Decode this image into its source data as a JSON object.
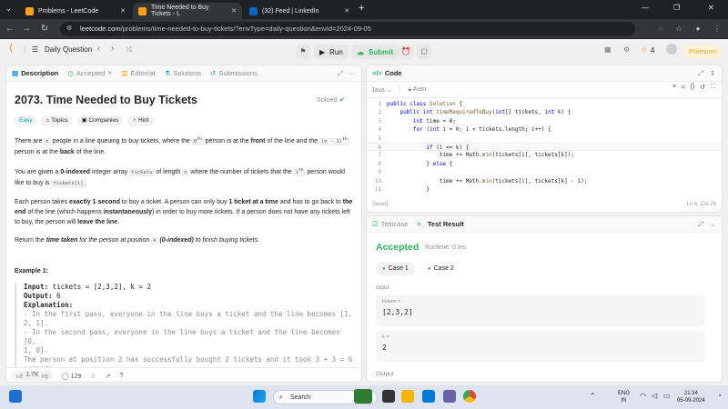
{
  "browser": {
    "tabs": [
      {
        "title": "Problems - LeetCode",
        "active": false
      },
      {
        "title": "Time Needed to Buy Tickets - L",
        "active": true
      },
      {
        "title": "(32) Feed | LinkedIn",
        "active": false
      }
    ],
    "new_tab": "+",
    "url_host": "leetcode.com",
    "url_path": "/problems/time-needed-to-buy-tickets/?envType=daily-question&envId=2024-09-05"
  },
  "header": {
    "daily_question": "Daily Question",
    "run": "Run",
    "submit": "Submit",
    "streak_count": "4",
    "premium": "Premium"
  },
  "description": {
    "tabs": [
      "Description",
      "Accepted",
      "Editorial",
      "Solutions",
      "Submissions"
    ],
    "title": "2073. Time Needed to Buy Tickets",
    "solved": "Solved",
    "tags": [
      "Easy",
      "Topics",
      "Companies",
      "Hint"
    ],
    "p1": {
      "a": "There are ",
      "n": "n",
      "b": " people in a line queuing to buy tickets, where the ",
      "zeroth": "0",
      "sup_th": "th",
      "c": " person is at the ",
      "front": "front",
      "d": " of the line and the ",
      "nminus1": "(n - 1)",
      "e": " person is at the ",
      "back": "back",
      "f": " of the line."
    },
    "p2": {
      "a": "You are given a ",
      "zero_indexed": "0-indexed",
      "b": " integer array ",
      "tickets": "tickets",
      "c": " of length ",
      "n": "n",
      "d": " where the number of tickets that the ",
      "i": "i",
      "e": " person would like to buy is ",
      "ticketsi": "tickets[i]",
      "f": "."
    },
    "p3": {
      "a": "Each person takes ",
      "one_second": "exactly 1 second",
      "b": " to buy a ticket. A person can only buy ",
      "one_ticket": "1 ticket at a time",
      "c": " and has to go back to ",
      "the_end": "the end",
      "d": " of the line (which happens ",
      "instantaneously": "instantaneously",
      "e": ") in order to buy more tickets. If a person does not have any tickets left to buy, the person will ",
      "leave": "leave the line",
      "f": "."
    },
    "p4": {
      "a": "Return the ",
      "time_taken": "time taken",
      "b": " for the person at position ",
      "k": "k",
      "c": " ",
      "zero_indexed": "(0-indexed)",
      "d": " to finish buying tickets."
    },
    "example_title": "Example 1:",
    "example": {
      "input_label": "Input:",
      "input_value": " tickets = [2,3,2], k = 2",
      "output_label": "Output:",
      "output_value": " 6",
      "explanation_label": "Explanation:",
      "lines": [
        "- In the first pass, everyone in the line buys a ticket and the line becomes [1,",
        "2, 1].",
        "- In the second pass, everyone in the line buys a ticket and the line becomes [0,",
        "1, 0].",
        "The person at position 2 has successfully bought 2 tickets and it took 3 + 3 = 6",
        "seconds."
      ]
    },
    "footer": {
      "likes": "1.7K",
      "comments": "129"
    }
  },
  "code": {
    "tab": "Code",
    "language": "Java",
    "mode": "Auto",
    "lines": [
      {
        "n": "1",
        "tokens": [
          [
            "kw",
            "public class "
          ],
          [
            "fn",
            "Solution"
          ],
          [
            "",
            " {"
          ]
        ]
      },
      {
        "n": "2",
        "tokens": [
          [
            "",
            "    "
          ],
          [
            "kw",
            "public int "
          ],
          [
            "fn",
            "timeRequiredToBuy"
          ],
          [
            "",
            "("
          ],
          [
            "kw",
            "int"
          ],
          [
            "",
            "[] tickets, "
          ],
          [
            "kw",
            "int"
          ],
          [
            "",
            " k) {"
          ]
        ]
      },
      {
        "n": "3",
        "tokens": [
          [
            "",
            "        "
          ],
          [
            "kw",
            "int"
          ],
          [
            "",
            " time = 0;"
          ]
        ]
      },
      {
        "n": "4",
        "tokens": [
          [
            "",
            "        "
          ],
          [
            "kw",
            "for"
          ],
          [
            "",
            " ("
          ],
          [
            "kw",
            "int"
          ],
          [
            "",
            " i = 0; i < tickets.length; i++) {"
          ]
        ]
      },
      {
        "n": "5",
        "tokens": [
          [
            "",
            ""
          ]
        ]
      },
      {
        "n": "6",
        "tokens": [
          [
            "",
            "            "
          ],
          [
            "kw",
            "if"
          ],
          [
            "",
            " (i <= k) {"
          ]
        ]
      },
      {
        "n": "7",
        "tokens": [
          [
            "",
            "                time += Math."
          ],
          [
            "fn",
            "min"
          ],
          [
            "",
            "(tickets[i], tickets[k]);"
          ]
        ]
      },
      {
        "n": "8",
        "tokens": [
          [
            "",
            "            } "
          ],
          [
            "kw",
            "else"
          ],
          [
            "",
            " {"
          ]
        ]
      },
      {
        "n": "9",
        "tokens": [
          [
            "",
            ""
          ]
        ]
      },
      {
        "n": "10",
        "tokens": [
          [
            "",
            "                time += Math."
          ],
          [
            "fn",
            "min"
          ],
          [
            "",
            "(tickets[i], tickets[k] - 1);"
          ]
        ]
      },
      {
        "n": "11",
        "tokens": [
          [
            "",
            "            }"
          ]
        ]
      }
    ],
    "saved": "Saved",
    "cursor": "Ln 6, Col 26"
  },
  "result": {
    "tabs": [
      "Testcase",
      "Test Result"
    ],
    "status": "Accepted",
    "runtime": "Runtime: 0 ms",
    "cases": [
      "Case 1",
      "Case 2"
    ],
    "input_label": "Input",
    "inputs": [
      {
        "name": "tickets =",
        "value": "[2,3,2]"
      },
      {
        "name": "k =",
        "value": "2"
      }
    ],
    "output_label": "Output"
  },
  "taskbar": {
    "search_placeholder": "Search",
    "lang": "ENG",
    "region": "IN",
    "time": "21:34",
    "date": "05-09-2024"
  },
  "colors": {
    "accepted": "#2db55d",
    "easy": "#00af9b",
    "premium": "#ffa116",
    "keyword": "#0000ff"
  }
}
